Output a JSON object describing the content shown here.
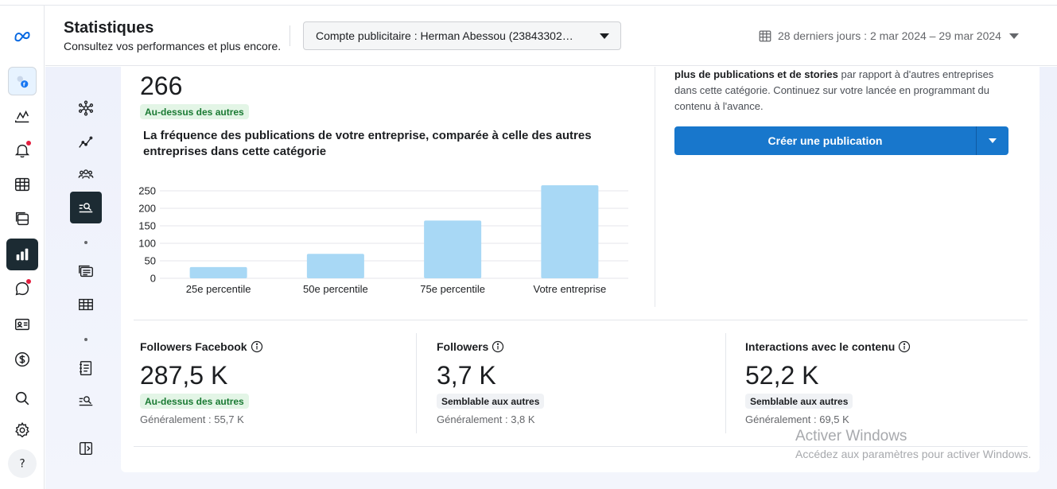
{
  "header": {
    "title": "Statistiques",
    "subtitle": "Consultez vos performances et plus encore.",
    "account_selector": "Compte publicitaire : Herman Abessou (23843302…",
    "date_range": "28 derniers jours : 2 mar 2024 – 29 mar 2024"
  },
  "rail_icons": [
    "meta-logo-icon",
    "page-avatar-icon",
    "insights-line-icon",
    "notifications-icon",
    "planner-icon",
    "content-icon",
    "statistics-icon",
    "inbox-icon",
    "contacts-icon",
    "billing-icon",
    "search-icon",
    "settings-icon",
    "help-icon"
  ],
  "subnav_icons": [
    "overview-icon",
    "trends-icon",
    "audience-icon",
    "benchmarking-icon",
    "content-stats-icon",
    "table-icon",
    "reports-icon",
    "search-results-icon",
    "collapse-panel-icon"
  ],
  "benchmark": {
    "value": "266",
    "badge": "Au-dessus des autres",
    "chart_title": "La fréquence des publications de votre entreprise, comparée à celle des autres entreprises dans cette catégorie"
  },
  "chart_data": {
    "type": "bar",
    "categories": [
      "25e percentile",
      "50e percentile",
      "75e percentile",
      "Votre entreprise"
    ],
    "values": [
      32,
      70,
      165,
      266
    ],
    "ylim": [
      0,
      250
    ],
    "yticks": [
      "250",
      "200",
      "150",
      "100",
      "50",
      "0"
    ],
    "bar_color": "#a8d8f5",
    "grid": true
  },
  "recommendation": {
    "bold_lead": "plus de publications et de stories",
    "text": " par rapport à d'autres entreprises dans cette catégorie. Continuez sur votre lancée en programmant du contenu à l'avance.",
    "button_label": "Créer une publication"
  },
  "metrics": [
    {
      "label": "Followers Facebook",
      "value": "287,5 K",
      "badge": "Au-dessus des autres",
      "typical": "Généralement : 55,7 K"
    },
    {
      "label": "Followers",
      "value": "3,7 K",
      "badge": "Semblable aux autres",
      "typical": "Généralement : 3,8 K"
    },
    {
      "label": "Interactions avec le contenu",
      "value": "52,2 K",
      "badge": "Semblable aux autres",
      "typical": "Généralement : 69,5 K"
    }
  ],
  "watermark": {
    "title": "Activer Windows",
    "subtitle": "Accédez aux paramètres pour activer Windows."
  },
  "colors": {
    "primary_button": "#1877cc",
    "good_badge_bg": "#e3f5e6",
    "good_badge_text": "#1a7a33",
    "active_nav": "#1c2b33",
    "notification_dot": "#e41e3f"
  }
}
